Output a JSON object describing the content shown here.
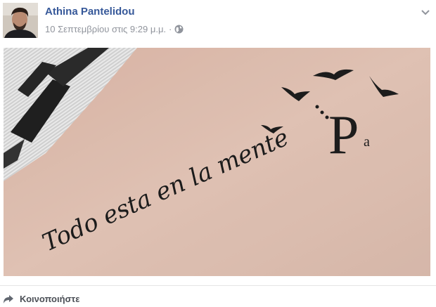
{
  "post": {
    "author": "Athina Pantelidou",
    "date": "10 Σεπτεμβρίου στις 9:29 μ.μ.",
    "separator": "·",
    "privacy_icon": "globe-icon",
    "options_icon": "chevron-down-icon"
  },
  "photo": {
    "tattoo_text": "Todo esta en la mente",
    "tattoo_initial": "P",
    "tattoo_small": "a"
  },
  "actions": {
    "share_label": "Κοινοποιήστε",
    "share_icon": "share-arrow-icon"
  }
}
